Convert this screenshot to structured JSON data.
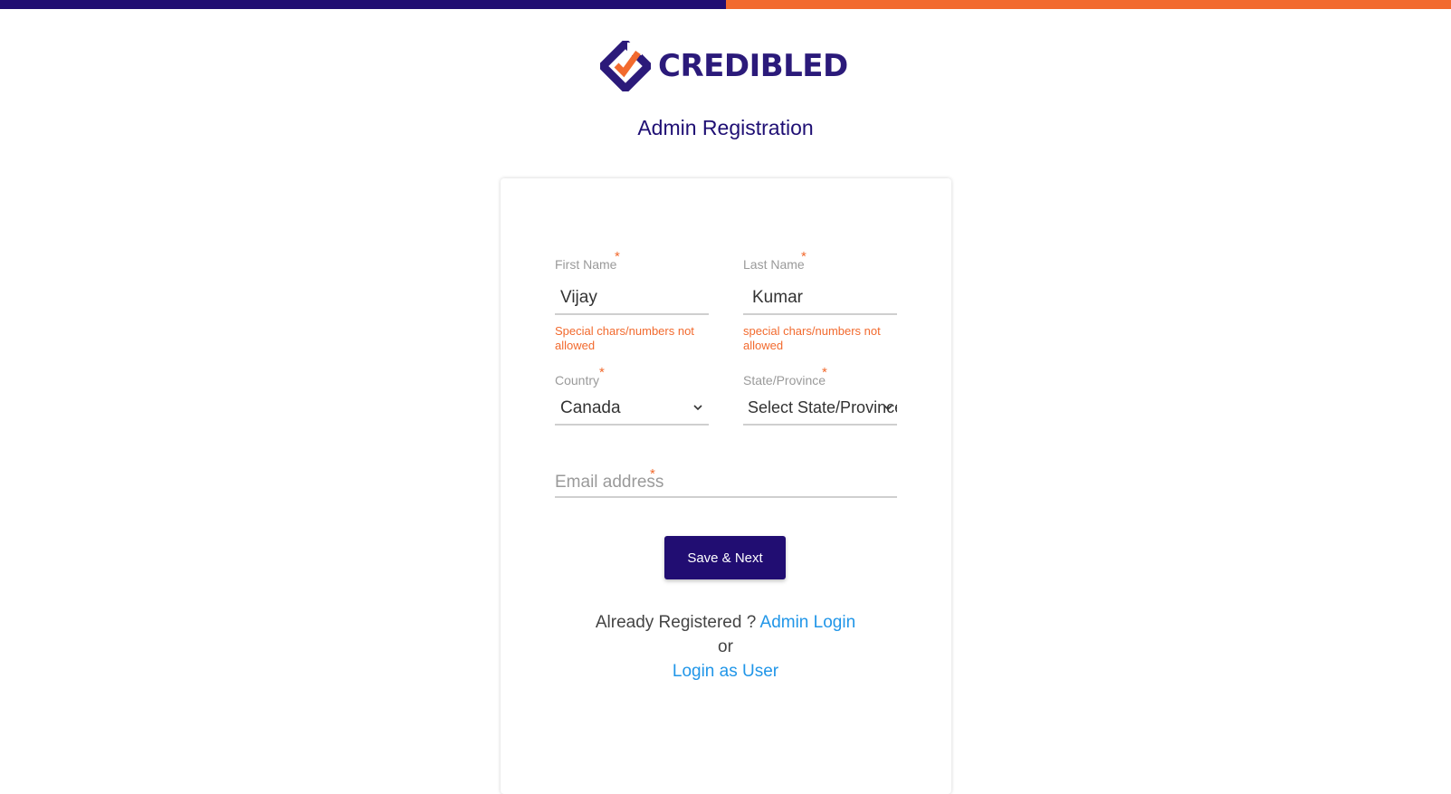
{
  "brand": {
    "logo_text": "CREDIBLED",
    "colors": {
      "primary": "#210d72",
      "accent": "#f26a2e",
      "link": "#2196e8"
    }
  },
  "page": {
    "title": "Admin Registration"
  },
  "form": {
    "first_name": {
      "label": "First Name",
      "required_mark": "*",
      "value": "Vijay",
      "error": "Special chars/numbers not allowed"
    },
    "last_name": {
      "label": "Last Name",
      "required_mark": "*",
      "value": "Kumar",
      "error": "special chars/numbers not allowed"
    },
    "country": {
      "label": "Country",
      "required_mark": "*",
      "selected": "Canada"
    },
    "state": {
      "label": "State/Province",
      "required_mark": "*",
      "selected": "Select State/Province"
    },
    "email": {
      "placeholder": "Email address",
      "required_mark": "*"
    },
    "submit_label": "Save & Next"
  },
  "footer": {
    "already_registered": "Already Registered ?",
    "admin_login": "Admin Login",
    "or": "or",
    "login_as_user": "Login as User"
  }
}
